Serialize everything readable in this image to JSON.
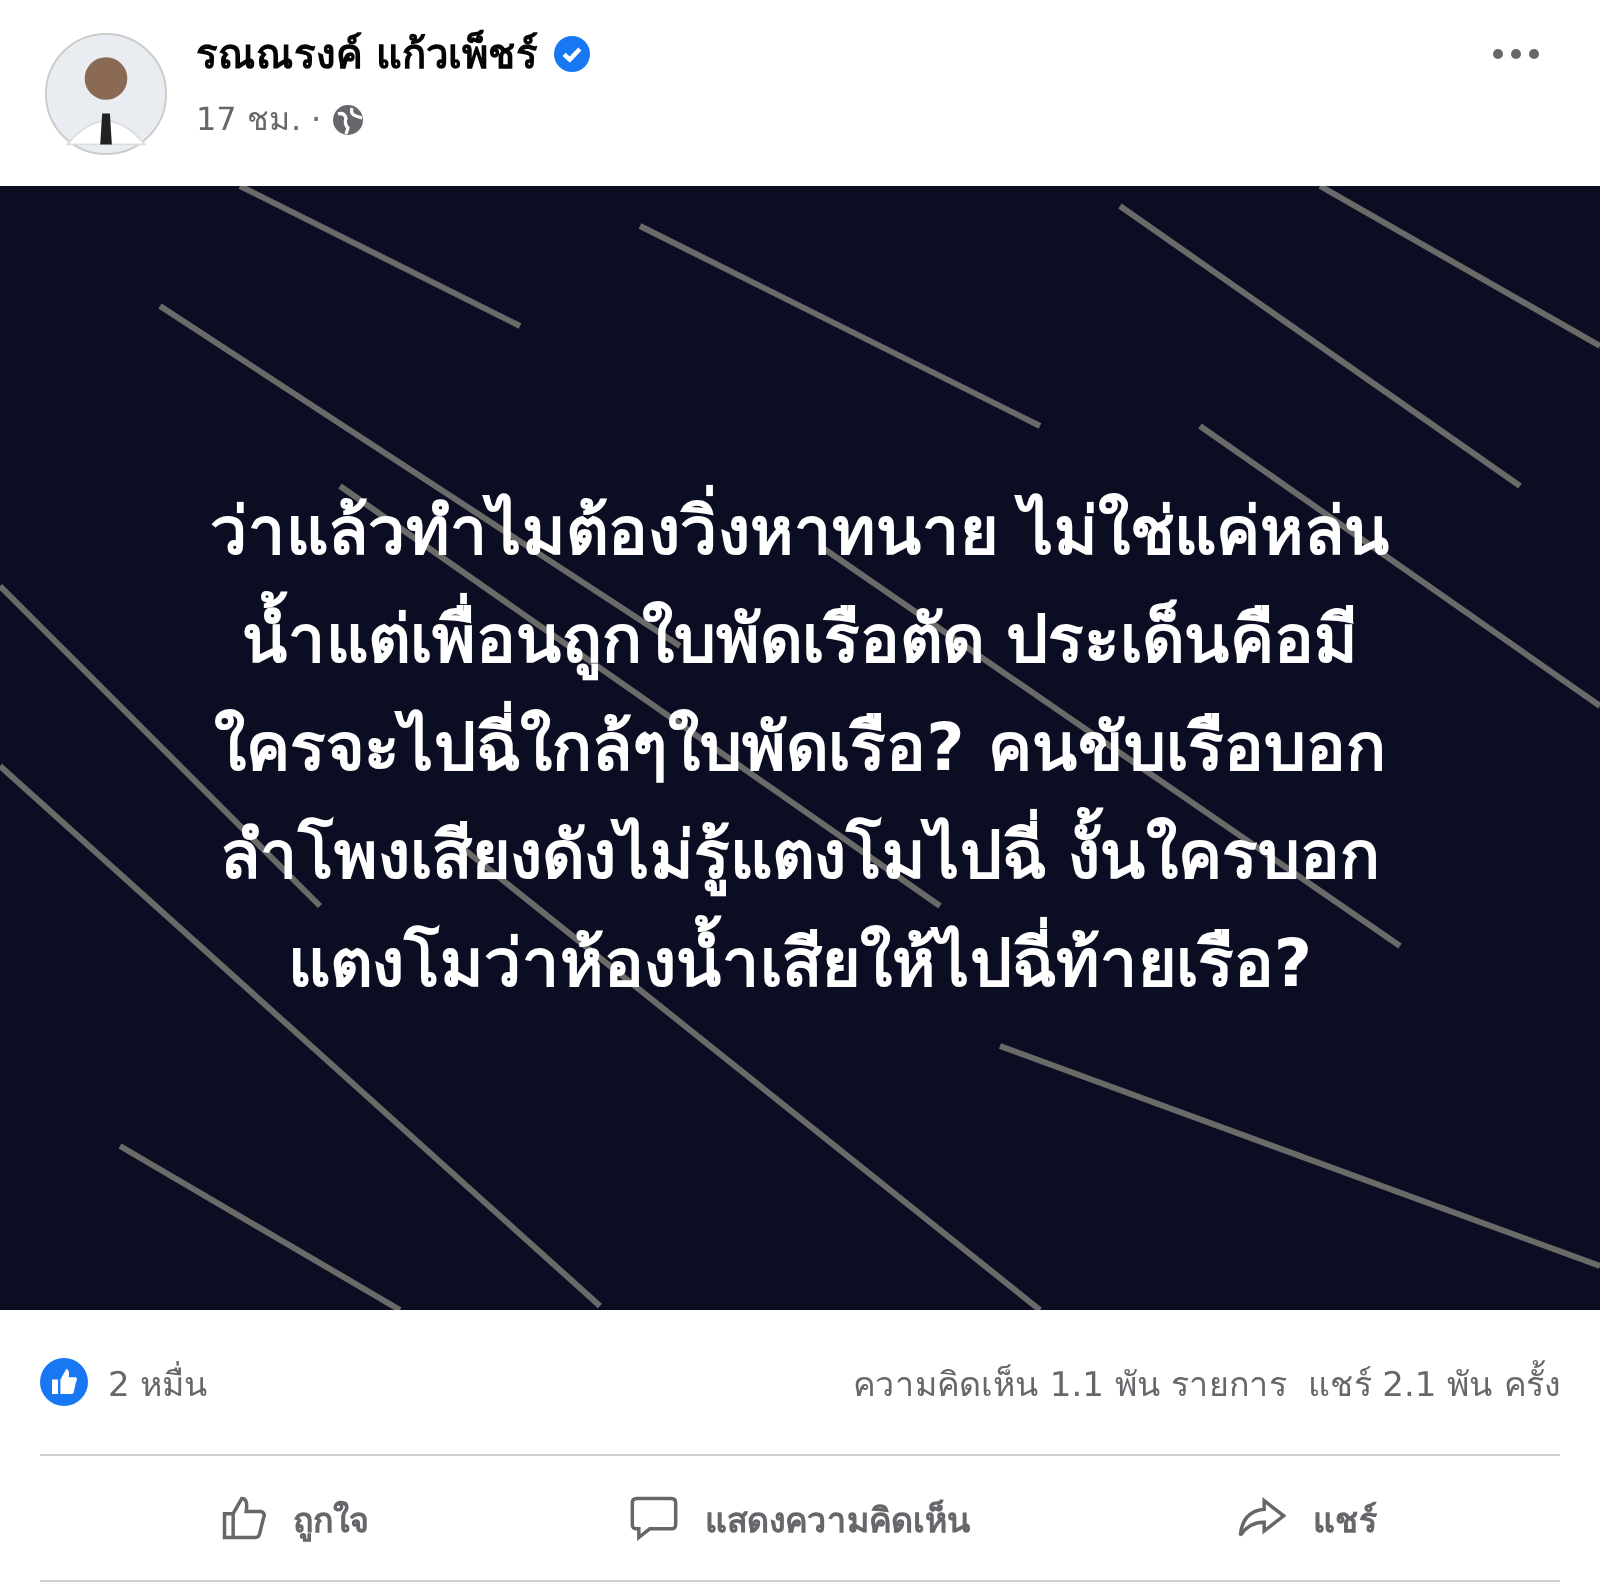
{
  "author": {
    "name": "รณณรงค์ แก้วเพ็ชร์",
    "verified": true,
    "time": "17 ชม.",
    "separator": "·",
    "public": true
  },
  "image": {
    "kind": "picture",
    "lines": [
      "ว่าแล้วทำไมต้องวิ่งหาทนาย ไม่ใช่แค่หล่น",
      "น้ำแต่เพื่อนถูกใบพัดเรือตัด ประเด็นคือมี",
      "ใครจะไปฉี่ใกล้ๆใบพัดเรือ? คนขับเรือบอก",
      "ลำโพงเสียงดังไม่รู้แตงโมไปฉี่ งั้นใครบอก",
      "แตงโมว่าห้องน้ำเสียให้ไปฉี่ท้ายเรือ?"
    ]
  },
  "stats": {
    "reactions": "2 หมื่น",
    "comments": "ความคิดเห็น 1.1 พัน รายการ",
    "shares": "แชร์ 2.1 พัน ครั้ง"
  },
  "actions": [
    {
      "kind": "like",
      "label": "ถูกใจ"
    },
    {
      "kind": "comment",
      "label": "แสดงความคิดเห็น"
    },
    {
      "kind": "share",
      "label": "แชร์"
    }
  ]
}
